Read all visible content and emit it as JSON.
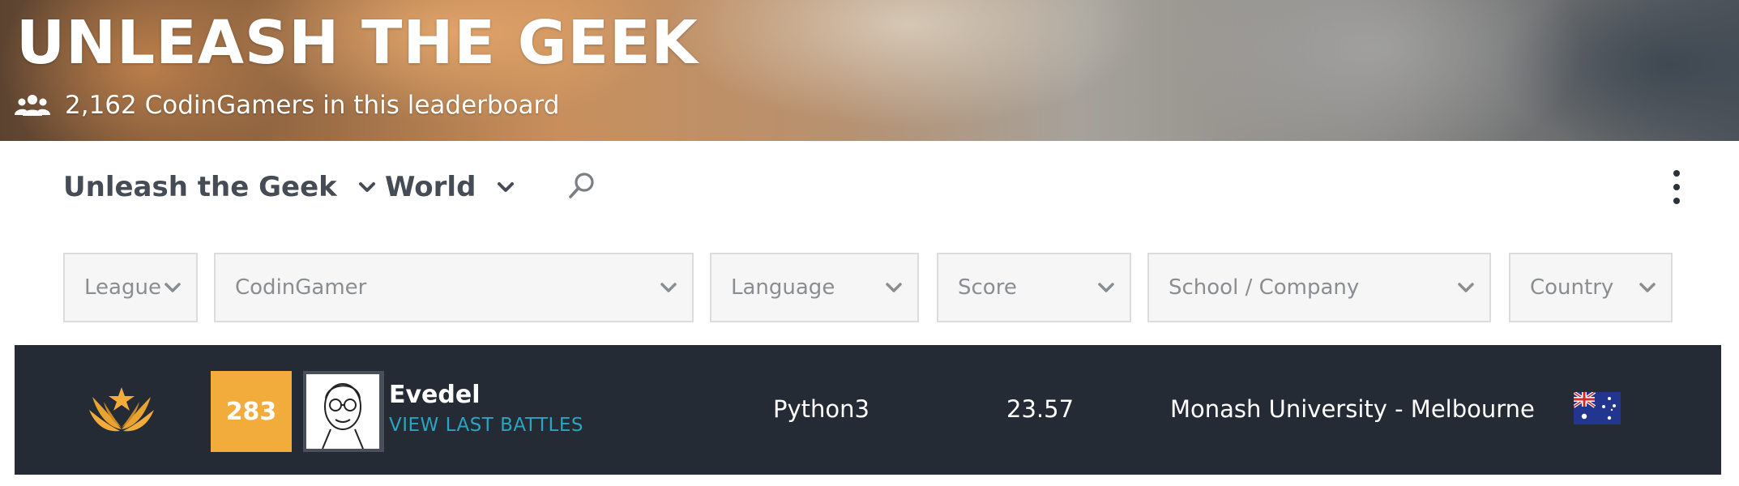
{
  "hero": {
    "title": "UNLEASH THE GEEK",
    "players_count_text": "2,162 CodinGamers in this leaderboard",
    "players_icon": "players-icon"
  },
  "topbar": {
    "game_selector": "Unleash the Geek",
    "region_selector": "World",
    "search_icon": "search-icon",
    "more_icon": "more-vertical-icon"
  },
  "filters": [
    {
      "label": "League"
    },
    {
      "label": "CodinGamer"
    },
    {
      "label": "Language"
    },
    {
      "label": "Score"
    },
    {
      "label": "School / Company"
    },
    {
      "label": "Country"
    }
  ],
  "row": {
    "league_icon": "legend-league-icon",
    "rank": "283",
    "player_name": "Evedel",
    "last_battles": "VIEW LAST BATTLES",
    "language": "Python3",
    "score": "23.57",
    "school": "Monash University - Melbourne",
    "country_flag": "australia-flag-icon"
  },
  "colors": {
    "row_bg": "#252b35",
    "rank_bg": "#f2ac3c",
    "link": "#2aa4c1",
    "selector_text": "#454c55",
    "filter_bg": "#f6f6f6"
  }
}
